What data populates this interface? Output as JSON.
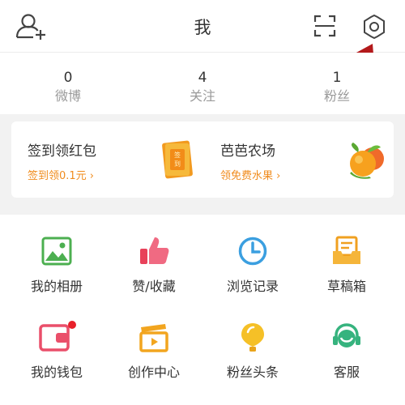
{
  "header": {
    "title": "我"
  },
  "icons": {
    "add_friend": "add-friend-icon",
    "scan": "scan-icon",
    "settings": "gear-icon"
  },
  "stats": [
    {
      "count": "0",
      "label": "微博"
    },
    {
      "count": "4",
      "label": "关注"
    },
    {
      "count": "1",
      "label": "粉丝"
    }
  ],
  "promo": {
    "left": {
      "title": "签到领红包",
      "subtitle": "签到领0.1元 ›",
      "icon_text": "签到"
    },
    "right": {
      "title": "芭芭农场",
      "subtitle": "领免费水果 ›"
    }
  },
  "grid": [
    {
      "label": "我的相册",
      "icon": "album-icon"
    },
    {
      "label": "赞/收藏",
      "icon": "thumbs-up-icon"
    },
    {
      "label": "浏览记录",
      "icon": "history-clock-icon"
    },
    {
      "label": "草稿箱",
      "icon": "drafts-icon"
    },
    {
      "label": "我的钱包",
      "icon": "wallet-icon"
    },
    {
      "label": "创作中心",
      "icon": "video-clapper-icon"
    },
    {
      "label": "粉丝头条",
      "icon": "balloon-icon"
    },
    {
      "label": "客服",
      "icon": "headset-icon"
    }
  ],
  "colors": {
    "accent_orange": "#f08c1e",
    "annotation_red": "#b3191b",
    "badge_red": "#e8202a"
  }
}
